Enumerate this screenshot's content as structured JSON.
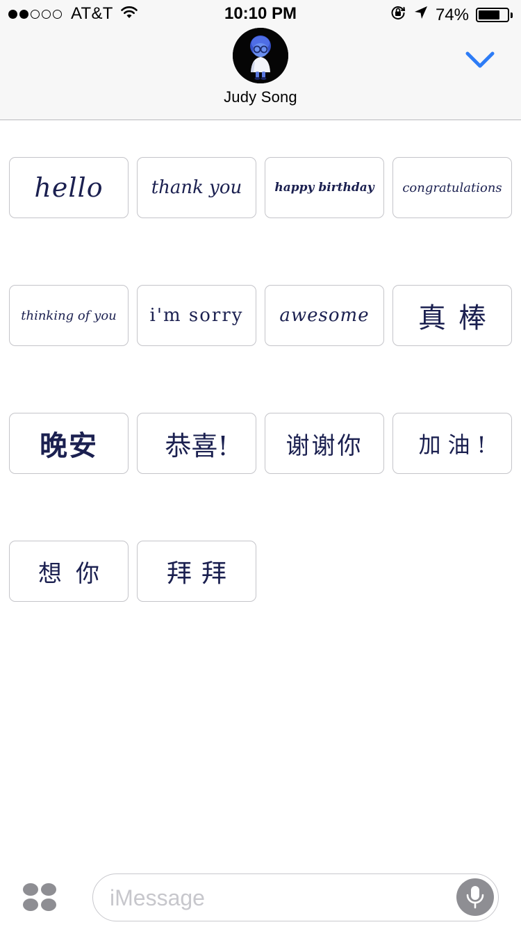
{
  "status_bar": {
    "carrier": "AT&T",
    "time": "10:10 PM",
    "battery_percent": "74%",
    "battery_level": 0.74,
    "signal_bars_filled": 2,
    "signal_bars_total": 5
  },
  "conversation": {
    "contact_name": "Judy Song",
    "avatar_icon": "sadness-character-avatar",
    "collapse_icon": "chevron-down-icon"
  },
  "stickers": [
    {
      "text": "hello",
      "lang": "en"
    },
    {
      "text": "thank you",
      "lang": "en"
    },
    {
      "text": "happy birthday",
      "lang": "en"
    },
    {
      "text": "congratulations",
      "lang": "en"
    },
    {
      "text": "thinking of you",
      "lang": "en"
    },
    {
      "text": "i'm sorry",
      "lang": "en"
    },
    {
      "text": "awesome",
      "lang": "en"
    },
    {
      "text": "真棒",
      "lang": "zh"
    },
    {
      "text": "晚安",
      "lang": "zh"
    },
    {
      "text": "恭喜!",
      "lang": "zh"
    },
    {
      "text": "谢谢你",
      "lang": "zh"
    },
    {
      "text": "加油!",
      "lang": "zh"
    },
    {
      "text": "想你",
      "lang": "zh"
    },
    {
      "text": "拜拜",
      "lang": "zh"
    }
  ],
  "composer": {
    "placeholder": "iMessage",
    "value": "",
    "apps_icon": "app-drawer-icon",
    "mic_icon": "microphone-icon"
  },
  "colors": {
    "accent": "#2d7cf6",
    "ink": "#1b2050",
    "card_border": "#c4c4c9",
    "mic_bg": "#8e8e93"
  }
}
